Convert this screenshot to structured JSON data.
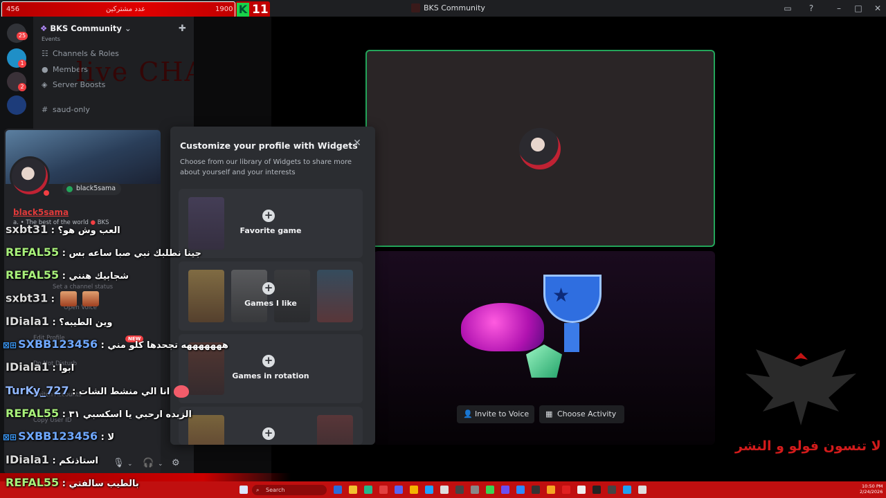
{
  "window": {
    "title": "BKS Community"
  },
  "overlay": {
    "left_num": "456",
    "center_text": "عدد مشتركين",
    "right_num": "1900",
    "k_letter": "K",
    "k_number": "11"
  },
  "rail": {
    "badges": [
      "25",
      "1",
      "2"
    ]
  },
  "sidebar": {
    "server_name": "BKS Community",
    "partial_top": "Events",
    "items": [
      {
        "label": "Channels & Roles"
      },
      {
        "label": "Members"
      },
      {
        "label": "Server Boosts"
      }
    ],
    "channel": "saud-only"
  },
  "decoration": {
    "live_chat": "live CHAT"
  },
  "profile": {
    "username": "black5sama",
    "display_name": "black5sama",
    "bio": "a. • The best of the world",
    "tag": "BKS",
    "faint_status": "Set a channel status",
    "faint_edit": "Edit Profile",
    "faint_dnd": "Do Not Disturb",
    "faint_switch": "Switch Accounts",
    "faint_copy": "Copy User ID",
    "faint_open": "Open Voice"
  },
  "widgets_modal": {
    "title": "Customize your profile with Widgets",
    "subtitle": "Choose from our library of Widgets to share more about yourself and your interests",
    "tiles": [
      {
        "label": "Favorite game"
      },
      {
        "label": "Games I like"
      },
      {
        "label": "Games in rotation"
      },
      {
        "label": ""
      }
    ]
  },
  "activity": {
    "invite_label": "Invite to Voice",
    "choose_label": "Choose Activity"
  },
  "chat": [
    {
      "user": "sxbt31",
      "sep": " : ",
      "msg": "العب وش هو؟",
      "color": "#dcdcdc"
    },
    {
      "user": "REFAL55",
      "sep": " : ",
      "msg": "جينا نطلبك نبي صبا ساعه بس",
      "color": "#a8f07a"
    },
    {
      "user": "REFAL55",
      "sep": " : ",
      "msg": "شجابيك هنني",
      "color": "#a8f07a"
    },
    {
      "user": "sxbt31",
      "sep": " : ",
      "msg": "",
      "color": "#dcdcdc"
    },
    {
      "user": "IDiala1",
      "sep": " : ",
      "msg": "وين الطيبه؟",
      "color": "#dcdcdc"
    },
    {
      "user": "SXBB123456",
      "sep": " : ",
      "msg": "هههههههه تجحدها كلو مني",
      "color": "#6fa8ff"
    },
    {
      "user": "IDiala1",
      "sep": " : ",
      "msg": "ابوا",
      "color": "#dcdcdc"
    },
    {
      "user": "TurKy_727",
      "sep": " : ",
      "msg": "انا الي منشط الشات",
      "color": "#8fb6ff"
    },
    {
      "user": "REFAL55",
      "sep": " : ",
      "msg": "الزبده ارحبي يا اسكسبي ٣١",
      "color": "#a8f07a"
    },
    {
      "user": "SXBB123456",
      "sep": " : ",
      "msg": "لا",
      "color": "#6fa8ff"
    },
    {
      "user": "IDiala1",
      "sep": " : ",
      "msg": "استاذنكم",
      "color": "#dcdcdc"
    },
    {
      "user": "REFAL55",
      "sep": " : ",
      "msg": "بالطيب سالفتي",
      "color": "#a8f07a"
    }
  ],
  "chat_badge": "NEW",
  "watermark": {
    "follow_text": "لا تنسون فولو و النشر"
  },
  "taskbar": {
    "search": "Search",
    "time": "10:50 PM",
    "date": "2/24/2026"
  },
  "colors": {
    "accent_green": "#23a55a",
    "brand_red": "#c00f0f",
    "discord_dark": "#1e1f22"
  }
}
